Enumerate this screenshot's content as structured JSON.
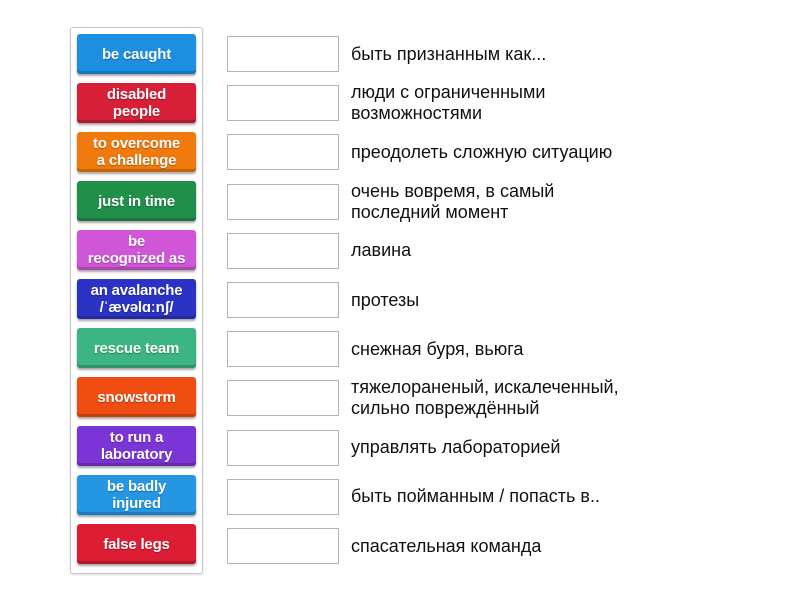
{
  "tiles": [
    {
      "label": "be caught",
      "color": "#1e8fe0"
    },
    {
      "label": "disabled\npeople",
      "color": "#d81f38"
    },
    {
      "label": "to overcome\na challenge",
      "color": "#f07a0e"
    },
    {
      "label": "just in time",
      "color": "#1f8f4a"
    },
    {
      "label": "be\nrecognized as",
      "color": "#cf56d6"
    },
    {
      "label": "an avalanche\n/ˈævəlɑːnʃ/",
      "color": "#2a33c4"
    },
    {
      "label": "rescue team",
      "color": "#3bb583"
    },
    {
      "label": "snowstorm",
      "color": "#f04d12"
    },
    {
      "label": "to run a\nlaboratory",
      "color": "#7b35d6"
    },
    {
      "label": "be badly\ninjured",
      "color": "#2596e2"
    },
    {
      "label": "false legs",
      "color": "#dc1d33"
    }
  ],
  "definitions": [
    "быть признанным как...",
    "люди с ограниченными\nвозможностями",
    "преодолеть сложную ситуацию",
    "очень вовремя, в самый\nпоследний момент",
    "лавина",
    "протезы",
    "снежная буря, вьюга",
    "тяжелораненый, искалеченный,\nсильно повреждённый",
    "управлять лабораторией",
    "быть пойманным / попасть в..",
    "спасательная команда"
  ]
}
